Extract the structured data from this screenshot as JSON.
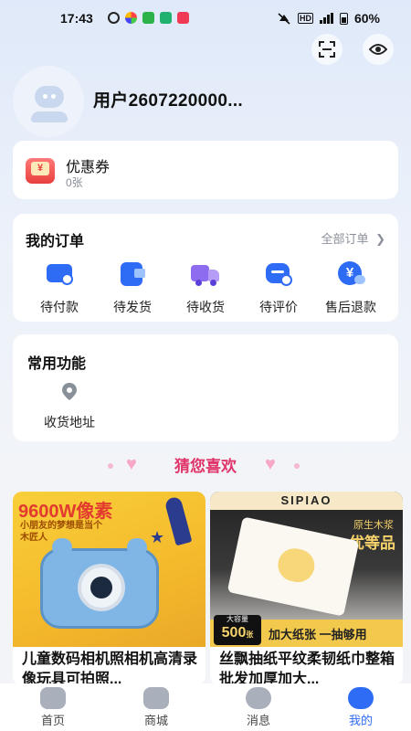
{
  "status_bar": {
    "time": "17:43",
    "network": "HD",
    "battery": "60%"
  },
  "user": {
    "name": "用户2607220000..."
  },
  "coupon": {
    "label": "优惠券",
    "count": "0张",
    "icon_char": "¥"
  },
  "orders": {
    "title": "我的订单",
    "all_orders": "全部订单",
    "items": [
      {
        "label": "待付款",
        "icon": "wallet-icon"
      },
      {
        "label": "待发货",
        "icon": "package-icon"
      },
      {
        "label": "待收货",
        "icon": "truck-icon"
      },
      {
        "label": "待评价",
        "icon": "review-icon"
      },
      {
        "label": "售后退款",
        "icon": "refund-icon"
      }
    ]
  },
  "functions": {
    "title": "常用功能",
    "items": [
      {
        "label": "收货地址",
        "icon": "location-icon"
      }
    ]
  },
  "recommend": {
    "title": "猜您喜欢"
  },
  "products": [
    {
      "image_text": "9600W像素",
      "image_subtext": "小朋友的梦想是当个木匠人",
      "title": "儿童数码相机照相机高清录像玩具可拍照..."
    },
    {
      "image_brand": "SIPIAO",
      "image_badge_top": "原生木浆",
      "image_badge_main": "优等品",
      "image_capacity_label": "大容量",
      "image_count": "500",
      "image_count_unit": "张",
      "image_slogan": "加大纸张 一抽够用",
      "title": "丝飘抽纸平纹柔韧纸巾整箱批发加厚加大..."
    }
  ],
  "tabbar": {
    "items": [
      {
        "label": "首页",
        "active": false
      },
      {
        "label": "商城",
        "active": false
      },
      {
        "label": "消息",
        "active": false
      },
      {
        "label": "我的",
        "active": true
      }
    ]
  },
  "colors": {
    "accent": "#2f6cf6",
    "pink": "#e0356a",
    "coupon_red": "#e8403c"
  }
}
